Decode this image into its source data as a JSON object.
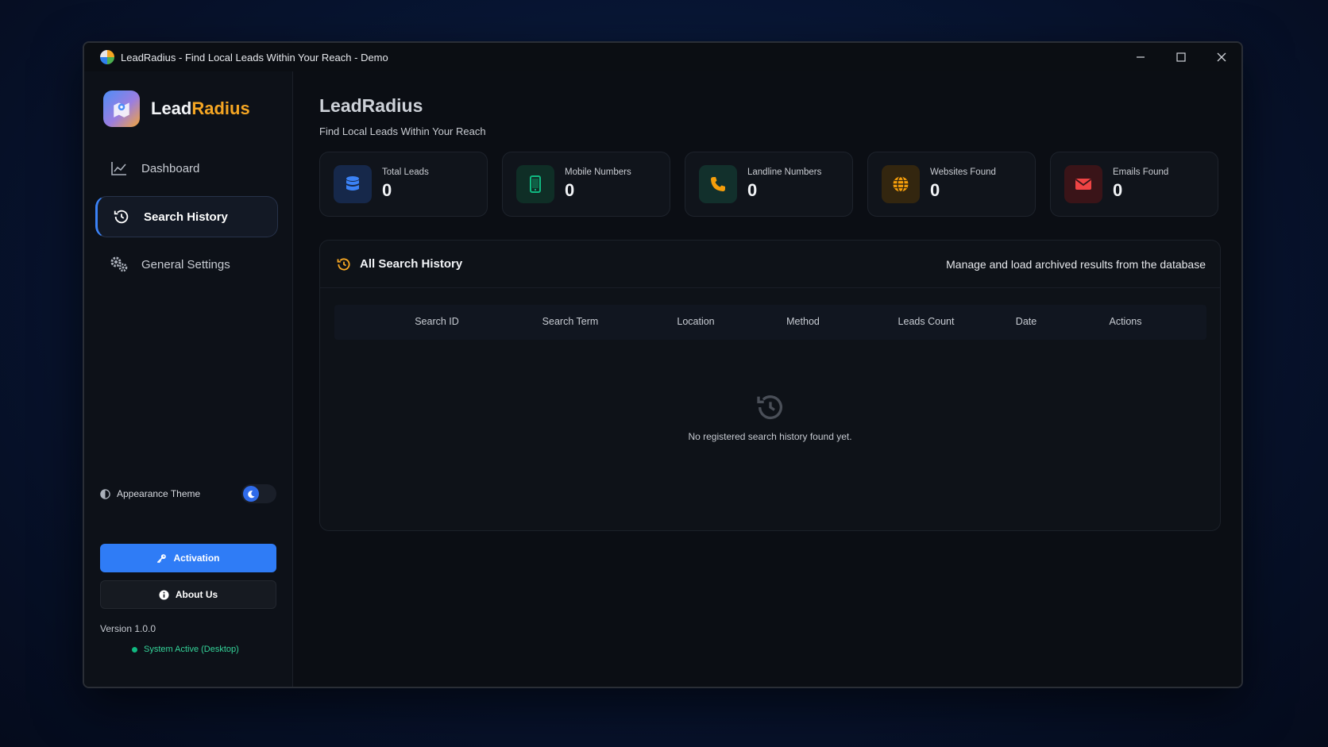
{
  "window": {
    "title": "LeadRadius - Find Local Leads Within Your Reach - Demo"
  },
  "brand": {
    "name_part1": "Lead",
    "name_part2": "Radius"
  },
  "sidebar": {
    "items": [
      {
        "label": "Dashboard",
        "icon": "chart-line-icon",
        "active": false
      },
      {
        "label": "Search History",
        "icon": "history-icon",
        "active": true
      },
      {
        "label": "General Settings",
        "icon": "gears-icon",
        "active": false
      }
    ],
    "theme_label": "Appearance Theme",
    "activation_label": "Activation",
    "about_label": "About Us",
    "version": "Version 1.0.0",
    "status": "System Active (Desktop)"
  },
  "header": {
    "title": "LeadRadius",
    "subtitle": "Find Local Leads Within Your Reach"
  },
  "stats": [
    {
      "label": "Total Leads",
      "value": "0",
      "icon": "database-icon",
      "color": "#3b82f6"
    },
    {
      "label": "Mobile Numbers",
      "value": "0",
      "icon": "mobile-icon",
      "color": "#10b981"
    },
    {
      "label": "Landline Numbers",
      "value": "0",
      "icon": "phone-icon",
      "color": "#f59e0b"
    },
    {
      "label": "Websites Found",
      "value": "0",
      "icon": "globe-icon",
      "color": "#f59e0b"
    },
    {
      "label": "Emails Found",
      "value": "0",
      "icon": "envelope-icon",
      "color": "#ef4444"
    }
  ],
  "panel": {
    "title": "All Search History",
    "description": "Manage and load archived results from the database",
    "columns": [
      "Search ID",
      "Search Term",
      "Location",
      "Method",
      "Leads Count",
      "Date",
      "Actions"
    ],
    "empty_message": "No registered search history found yet."
  },
  "colors": {
    "accent": "#2f7cf6",
    "brand_orange": "#f5a623",
    "status_green": "#10b981"
  }
}
